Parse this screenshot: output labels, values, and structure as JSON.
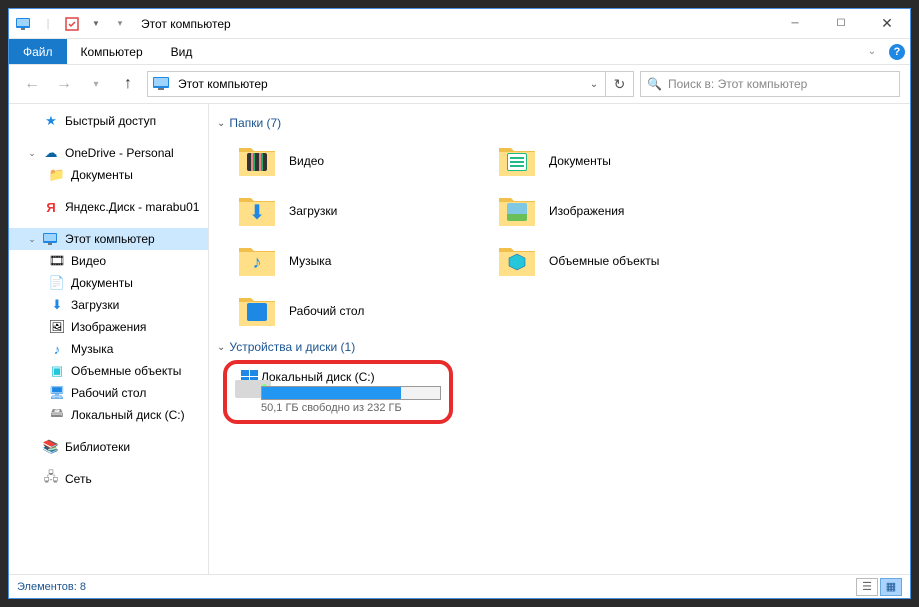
{
  "title": "Этот компьютер",
  "menu": {
    "file": "Файл",
    "computer": "Компьютер",
    "view": "Вид"
  },
  "nav": {
    "breadcrumb": "Этот компьютер",
    "search_placeholder": "Поиск в: Этот компьютер"
  },
  "sidebar": {
    "quick": "Быстрый доступ",
    "onedrive": "OneDrive - Personal",
    "onedrive_docs": "Документы",
    "yandex": "Яндекс.Диск - marabu01",
    "thispc": "Этот компьютер",
    "video": "Видео",
    "docs": "Документы",
    "downloads": "Загрузки",
    "images": "Изображения",
    "music": "Музыка",
    "objects3d": "Объемные объекты",
    "desktop": "Рабочий стол",
    "localdisk": "Локальный диск (C:)",
    "libraries": "Библиотеки",
    "network": "Сеть"
  },
  "sections": {
    "folders": "Папки (7)",
    "devices": "Устройства и диски (1)"
  },
  "folders": {
    "video": "Видео",
    "docs": "Документы",
    "downloads": "Загрузки",
    "images": "Изображения",
    "music": "Музыка",
    "objects3d": "Объемные объекты",
    "desktop": "Рабочий стол"
  },
  "drive": {
    "name": "Локальный диск (C:)",
    "sub": "50,1 ГБ свободно из 232 ГБ",
    "used_pct": 78
  },
  "status": {
    "count": "Элементов: 8"
  }
}
